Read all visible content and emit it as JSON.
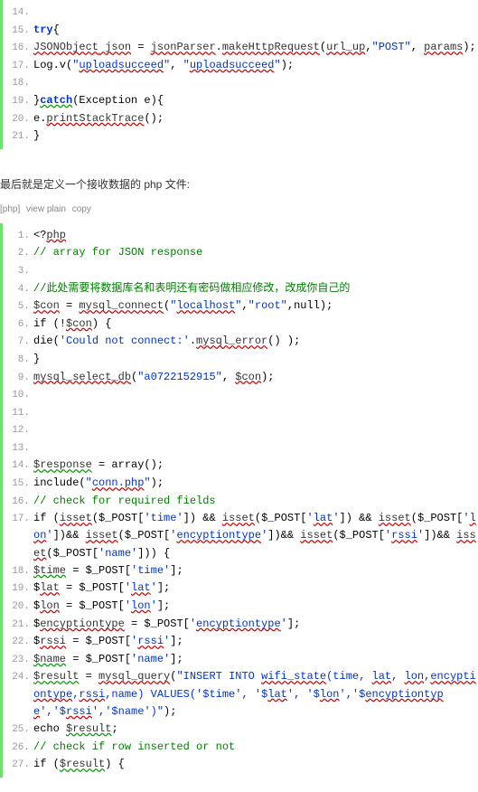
{
  "block1": {
    "lines": [
      {
        "n": "14.",
        "parts": []
      },
      {
        "n": "15.",
        "parts": [
          {
            "t": "try",
            "c": "kw"
          },
          {
            "t": "{",
            "c": "plain"
          }
        ]
      },
      {
        "n": "16.",
        "parts": [
          {
            "t": "JSONObject",
            "c": "err"
          },
          {
            "t": " ",
            "c": "plain err"
          },
          {
            "t": "json",
            "c": "err"
          },
          {
            "t": " = ",
            "c": "plain"
          },
          {
            "t": "jsonParser",
            "c": "err"
          },
          {
            "t": ".",
            "c": "plain"
          },
          {
            "t": "makeHttpRequest",
            "c": "err"
          },
          {
            "t": "(",
            "c": "plain"
          },
          {
            "t": "url_up",
            "c": "err"
          },
          {
            "t": ",",
            "c": "plain"
          },
          {
            "t": "\"POST\"",
            "c": "str"
          },
          {
            "t": ", ",
            "c": "plain"
          },
          {
            "t": "params",
            "c": "err"
          },
          {
            "t": ");",
            "c": "plain"
          }
        ]
      },
      {
        "n": "17.",
        "parts": [
          {
            "t": "Log.v(",
            "c": "plain"
          },
          {
            "t": "\"",
            "c": "str"
          },
          {
            "t": "uploadsucceed",
            "c": "str err"
          },
          {
            "t": "\"",
            "c": "str"
          },
          {
            "t": ", ",
            "c": "plain"
          },
          {
            "t": "\"",
            "c": "str"
          },
          {
            "t": "uploadsucceed",
            "c": "str err"
          },
          {
            "t": "\"",
            "c": "str"
          },
          {
            "t": ");",
            "c": "plain"
          }
        ]
      },
      {
        "n": "18.",
        "parts": []
      },
      {
        "n": "19.",
        "parts": [
          {
            "t": "}",
            "c": "plain"
          },
          {
            "t": "catch",
            "c": "kw err-g"
          },
          {
            "t": "(Exception e){",
            "c": "plain"
          }
        ]
      },
      {
        "n": "20.",
        "parts": [
          {
            "t": "e.",
            "c": "plain"
          },
          {
            "t": "printStackTrace",
            "c": "err"
          },
          {
            "t": "();",
            "c": "plain"
          }
        ]
      },
      {
        "n": "21.",
        "parts": [
          {
            "t": "}",
            "c": "plain"
          }
        ]
      }
    ]
  },
  "note_text": "最后就是定义一个接收数据的 php 文件:",
  "toolbar": {
    "php": "[php]",
    "view": "view plain",
    "copy": "copy"
  },
  "block2": {
    "lines": [
      {
        "n": "1.",
        "parts": [
          {
            "t": "<?",
            "c": "plain"
          },
          {
            "t": "php",
            "c": "err"
          }
        ]
      },
      {
        "n": "2.",
        "parts": [
          {
            "t": "// array for JSON response",
            "c": "comment"
          }
        ]
      },
      {
        "n": "3.",
        "parts": []
      },
      {
        "n": "4.",
        "parts": [
          {
            "t": "//此处需要将数据库名和表明还有密码做相应修改，改成你自己的",
            "c": "comment"
          }
        ]
      },
      {
        "n": "5.",
        "parts": [
          {
            "t": "$con",
            "c": "err"
          },
          {
            "t": " = ",
            "c": "plain"
          },
          {
            "t": "mysql_connect",
            "c": "err"
          },
          {
            "t": "(",
            "c": "plain"
          },
          {
            "t": "\"",
            "c": "str"
          },
          {
            "t": "localhost",
            "c": "str err"
          },
          {
            "t": "\"",
            "c": "str"
          },
          {
            "t": ",",
            "c": "plain"
          },
          {
            "t": "\"root\"",
            "c": "str"
          },
          {
            "t": ",null);",
            "c": "plain"
          }
        ]
      },
      {
        "n": "6.",
        "parts": [
          {
            "t": "if (!",
            "c": "plain"
          },
          {
            "t": "$con",
            "c": "err"
          },
          {
            "t": ") {",
            "c": "plain"
          }
        ]
      },
      {
        "n": "7.",
        "parts": [
          {
            "t": "die(",
            "c": "plain"
          },
          {
            "t": "'Could not connect:'",
            "c": "str"
          },
          {
            "t": ".",
            "c": "plain"
          },
          {
            "t": "mysql_error",
            "c": "err"
          },
          {
            "t": "() );",
            "c": "plain"
          }
        ]
      },
      {
        "n": "8.",
        "parts": [
          {
            "t": "}",
            "c": "plain"
          }
        ]
      },
      {
        "n": "9.",
        "parts": [
          {
            "t": "mysql_select_db",
            "c": "err"
          },
          {
            "t": "(",
            "c": "plain"
          },
          {
            "t": "\"a0722152915\"",
            "c": "str"
          },
          {
            "t": ", ",
            "c": "plain"
          },
          {
            "t": "$con",
            "c": "err"
          },
          {
            "t": ");",
            "c": "plain"
          }
        ]
      },
      {
        "n": "10.",
        "parts": []
      },
      {
        "n": "11.",
        "parts": []
      },
      {
        "n": "12.",
        "parts": []
      },
      {
        "n": "13.",
        "parts": []
      },
      {
        "n": "14.",
        "parts": [
          {
            "t": "$response",
            "c": "err-g"
          },
          {
            "t": " = array();",
            "c": "plain"
          }
        ]
      },
      {
        "n": "15.",
        "parts": [
          {
            "t": "include(",
            "c": "plain"
          },
          {
            "t": "\"",
            "c": "str"
          },
          {
            "t": "conn.php",
            "c": "str err"
          },
          {
            "t": "\"",
            "c": "str"
          },
          {
            "t": ");",
            "c": "plain"
          }
        ]
      },
      {
        "n": "16.",
        "parts": [
          {
            "t": "// check for required fields",
            "c": "comment"
          }
        ]
      },
      {
        "n": "17.",
        "parts": [
          {
            "t": "if (",
            "c": "plain"
          },
          {
            "t": "isset",
            "c": "err"
          },
          {
            "t": "($_POST[",
            "c": "plain"
          },
          {
            "t": "'time'",
            "c": "str"
          },
          {
            "t": "]) && ",
            "c": "plain"
          },
          {
            "t": "isset",
            "c": "err"
          },
          {
            "t": "($_POST[",
            "c": "plain"
          },
          {
            "t": "'",
            "c": "str"
          },
          {
            "t": "lat",
            "c": "str err"
          },
          {
            "t": "'",
            "c": "str"
          },
          {
            "t": "]) && ",
            "c": "plain"
          },
          {
            "t": "isset",
            "c": "err"
          },
          {
            "t": "($_POST[",
            "c": "plain"
          },
          {
            "t": "'",
            "c": "str"
          },
          {
            "t": "lon",
            "c": "str err"
          },
          {
            "t": "'",
            "c": "str"
          },
          {
            "t": "])&& ",
            "c": "plain"
          },
          {
            "t": "isset",
            "c": "err"
          },
          {
            "t": "($_POST[",
            "c": "plain"
          },
          {
            "t": "'",
            "c": "str"
          },
          {
            "t": "encyptiontype",
            "c": "str err"
          },
          {
            "t": "'",
            "c": "str"
          },
          {
            "t": "])&& ",
            "c": "plain"
          },
          {
            "t": "isset",
            "c": "err"
          },
          {
            "t": "($_POST[",
            "c": "plain"
          },
          {
            "t": "'",
            "c": "str"
          },
          {
            "t": "rssi",
            "c": "str err"
          },
          {
            "t": "'",
            "c": "str"
          },
          {
            "t": "])&& ",
            "c": "plain"
          },
          {
            "t": "isset",
            "c": "err"
          },
          {
            "t": "($_POST[",
            "c": "plain"
          },
          {
            "t": "'name'",
            "c": "str"
          },
          {
            "t": "])) {",
            "c": "plain"
          }
        ]
      },
      {
        "n": "18.",
        "parts": [
          {
            "t": "$time",
            "c": "err-g"
          },
          {
            "t": " = $_POST[",
            "c": "plain"
          },
          {
            "t": "'time'",
            "c": "str"
          },
          {
            "t": "];",
            "c": "plain"
          }
        ]
      },
      {
        "n": "19.",
        "parts": [
          {
            "t": "$",
            "c": "plain"
          },
          {
            "t": "lat",
            "c": "err"
          },
          {
            "t": " = $_POST[",
            "c": "plain"
          },
          {
            "t": "'",
            "c": "str"
          },
          {
            "t": "lat",
            "c": "str err"
          },
          {
            "t": "'",
            "c": "str"
          },
          {
            "t": "];",
            "c": "plain"
          }
        ]
      },
      {
        "n": "20.",
        "parts": [
          {
            "t": "$",
            "c": "plain"
          },
          {
            "t": "lon",
            "c": "err"
          },
          {
            "t": " = $_POST[",
            "c": "plain"
          },
          {
            "t": "'",
            "c": "str"
          },
          {
            "t": "lon",
            "c": "str err"
          },
          {
            "t": "'",
            "c": "str"
          },
          {
            "t": "];",
            "c": "plain"
          }
        ]
      },
      {
        "n": "21.",
        "parts": [
          {
            "t": "$",
            "c": "plain"
          },
          {
            "t": "encyptiontype",
            "c": "err"
          },
          {
            "t": " = $_POST[",
            "c": "plain"
          },
          {
            "t": "'",
            "c": "str"
          },
          {
            "t": "encyptiontype",
            "c": "str err"
          },
          {
            "t": "'",
            "c": "str"
          },
          {
            "t": "];",
            "c": "plain"
          }
        ]
      },
      {
        "n": "22.",
        "parts": [
          {
            "t": "$",
            "c": "plain"
          },
          {
            "t": "rssi",
            "c": "err"
          },
          {
            "t": " = $_POST[",
            "c": "plain"
          },
          {
            "t": "'",
            "c": "str"
          },
          {
            "t": "rssi",
            "c": "str err"
          },
          {
            "t": "'",
            "c": "str"
          },
          {
            "t": "];",
            "c": "plain"
          }
        ]
      },
      {
        "n": "23.",
        "parts": [
          {
            "t": "$name",
            "c": "err-g"
          },
          {
            "t": " = $_POST[",
            "c": "plain"
          },
          {
            "t": "'name'",
            "c": "str"
          },
          {
            "t": "];",
            "c": "plain"
          }
        ]
      },
      {
        "n": "24.",
        "parts": [
          {
            "t": "$result",
            "c": "err-g"
          },
          {
            "t": " = ",
            "c": "plain"
          },
          {
            "t": "mysql_query",
            "c": "err"
          },
          {
            "t": "(",
            "c": "plain"
          },
          {
            "t": "\"INSERT INTO ",
            "c": "str"
          },
          {
            "t": "wifi_state",
            "c": "str err"
          },
          {
            "t": "(time, ",
            "c": "str"
          },
          {
            "t": "lat",
            "c": "str err"
          },
          {
            "t": ", ",
            "c": "str"
          },
          {
            "t": "lon",
            "c": "str err"
          },
          {
            "t": ",",
            "c": "str"
          },
          {
            "t": "encyptiontype",
            "c": "str err"
          },
          {
            "t": ",",
            "c": "str"
          },
          {
            "t": "rssi",
            "c": "str err"
          },
          {
            "t": ",name) VALUES('$time', '$",
            "c": "str"
          },
          {
            "t": "lat",
            "c": "str err"
          },
          {
            "t": "', '$",
            "c": "str"
          },
          {
            "t": "lon",
            "c": "str err"
          },
          {
            "t": "','$",
            "c": "str"
          },
          {
            "t": "encyptiontype",
            "c": "str err"
          },
          {
            "t": "','$",
            "c": "str"
          },
          {
            "t": "rssi",
            "c": "str err"
          },
          {
            "t": "','$name')\"",
            "c": "str"
          },
          {
            "t": ");",
            "c": "plain"
          }
        ]
      },
      {
        "n": "25.",
        "parts": [
          {
            "t": "echo ",
            "c": "plain"
          },
          {
            "t": "$result",
            "c": "err-g"
          },
          {
            "t": ";",
            "c": "plain"
          }
        ]
      },
      {
        "n": "26.",
        "parts": [
          {
            "t": "// check if row inserted or not",
            "c": "comment"
          }
        ]
      },
      {
        "n": "27.",
        "parts": [
          {
            "t": "if (",
            "c": "plain"
          },
          {
            "t": "$result",
            "c": "err-g"
          },
          {
            "t": ") {",
            "c": "plain"
          }
        ]
      }
    ]
  }
}
